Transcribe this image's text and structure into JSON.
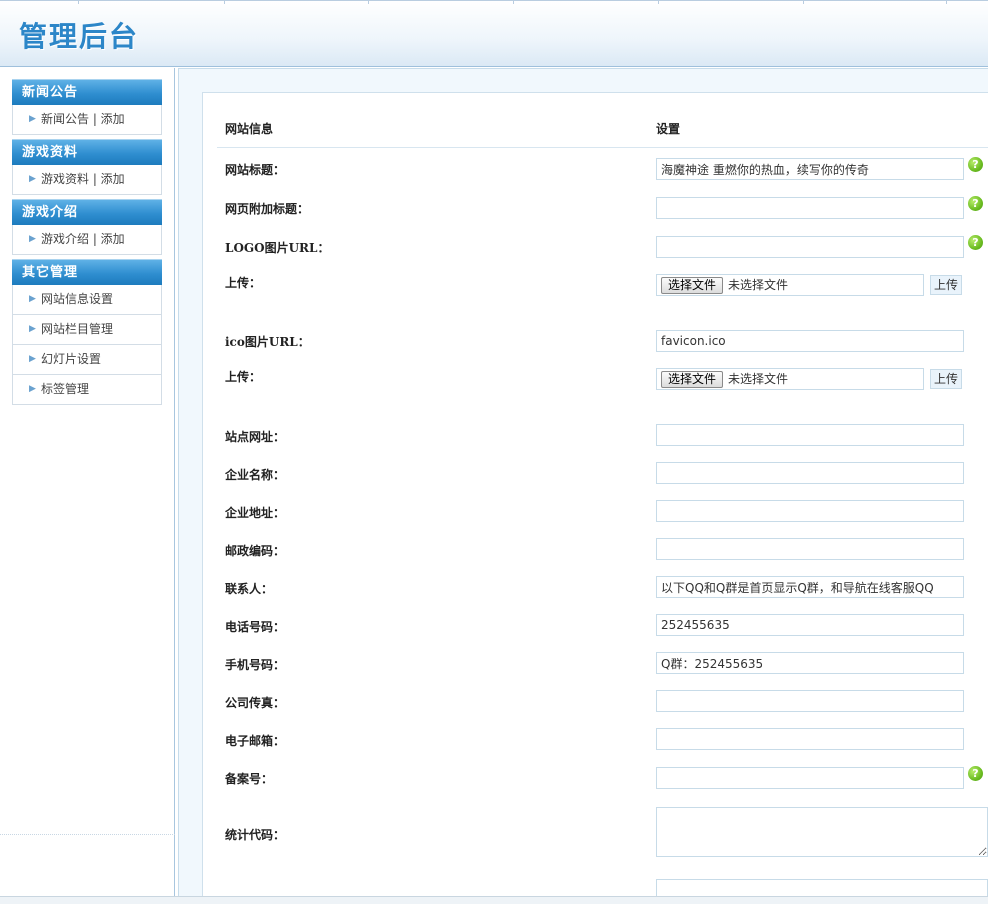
{
  "header": {
    "title": "管理后台"
  },
  "sidebar": {
    "groups": [
      {
        "title": "新闻公告",
        "items": [
          {
            "label": "新闻公告 | 添加"
          }
        ]
      },
      {
        "title": "游戏资料",
        "items": [
          {
            "label": "游戏资料 | 添加"
          }
        ]
      },
      {
        "title": "游戏介绍",
        "items": [
          {
            "label": "游戏介绍 | 添加"
          }
        ]
      },
      {
        "title": "其它管理",
        "items": [
          {
            "label": "网站信息设置"
          },
          {
            "label": "网站栏目管理"
          },
          {
            "label": "幻灯片设置"
          },
          {
            "label": "标签管理"
          }
        ]
      }
    ]
  },
  "form": {
    "col_left": "网站信息",
    "col_right": "设置",
    "help_glyph": "?",
    "file_button": "选择文件",
    "file_empty": "未选择文件",
    "upload_label": "上传",
    "rows": {
      "site_title": {
        "label": "网站标题：",
        "value": "海魔神途 重燃你的热血，续写你的传奇"
      },
      "extra_title": {
        "label": "网页附加标题：",
        "value": ""
      },
      "logo_url": {
        "label": "LOGO图片URL：",
        "value": ""
      },
      "logo_upload": {
        "label": "上传："
      },
      "ico_url": {
        "label": "ico图片URL：",
        "value": "favicon.ico"
      },
      "ico_upload": {
        "label": "上传："
      },
      "site_url": {
        "label": "站点网址：",
        "value": ""
      },
      "company_name": {
        "label": "企业名称：",
        "value": ""
      },
      "company_address": {
        "label": "企业地址：",
        "value": ""
      },
      "postcode": {
        "label": "邮政编码：",
        "value": ""
      },
      "contact": {
        "label": "联系人：",
        "value": "以下QQ和Q群是首页显示Q群，和导航在线客服QQ"
      },
      "phone": {
        "label": "电话号码：",
        "value": "252455635"
      },
      "mobile": {
        "label": "手机号码：",
        "value": "Q群：252455635"
      },
      "fax": {
        "label": "公司传真：",
        "value": ""
      },
      "email": {
        "label": "电子邮箱：",
        "value": ""
      },
      "icp": {
        "label": "备案号：",
        "value": ""
      },
      "stats_code": {
        "label": "统计代码：",
        "value": ""
      }
    }
  },
  "colors": {
    "accent": "#2c86c8",
    "menu_head": "#2f8ed0",
    "help_green": "#6cbd22"
  }
}
